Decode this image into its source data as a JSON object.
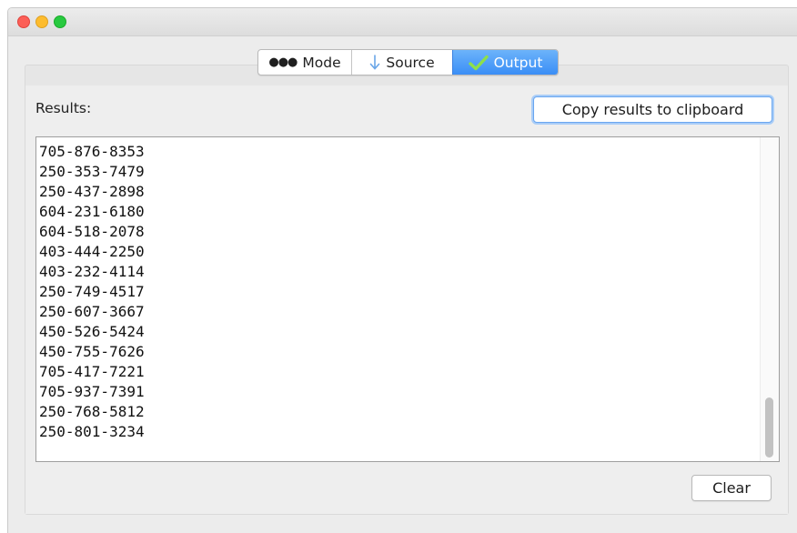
{
  "tabs": [
    {
      "label": "Mode",
      "icon": "dots-icon"
    },
    {
      "label": "Source",
      "icon": "down-arrow-icon"
    },
    {
      "label": "Output",
      "icon": "checkmark-icon",
      "selected": true
    }
  ],
  "results": {
    "label": "Results:",
    "copy_button": "Copy results to clipboard",
    "clear_button": "Clear",
    "lines": [
      "705-876-8353",
      "250-353-7479",
      "250-437-2898",
      "604-231-6180",
      "604-518-2078",
      "403-444-2250",
      "403-232-4114",
      "250-749-4517",
      "250-607-3667",
      "450-526-5424",
      "450-755-7626",
      "705-417-7221",
      "705-937-7391",
      "250-768-5812",
      "250-801-3234"
    ]
  },
  "colors": {
    "accent": "#3a8ef6",
    "close": "#fc5f57",
    "minimize": "#fdbc2e",
    "maximize": "#28c940",
    "check": "#7ed321"
  }
}
